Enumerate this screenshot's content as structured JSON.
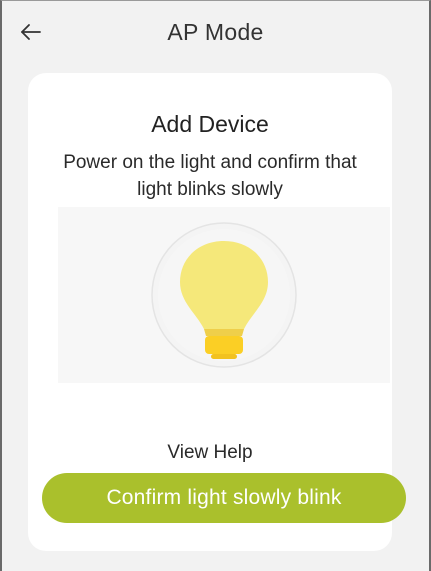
{
  "header": {
    "title": "AP Mode",
    "back_icon": "arrow-left-icon"
  },
  "card": {
    "heading": "Add Device",
    "instruction": "Power on the light and confirm that light blinks slowly",
    "illustration_icon": "light-bulb-icon",
    "view_help_label": "View Help",
    "confirm_label": "Confirm light slowly blink"
  },
  "colors": {
    "accent": "#aac02c",
    "bulb": "#f5e87a",
    "bulb_base": "#fbcf25",
    "background": "#f2f2f2",
    "card": "#ffffff"
  }
}
